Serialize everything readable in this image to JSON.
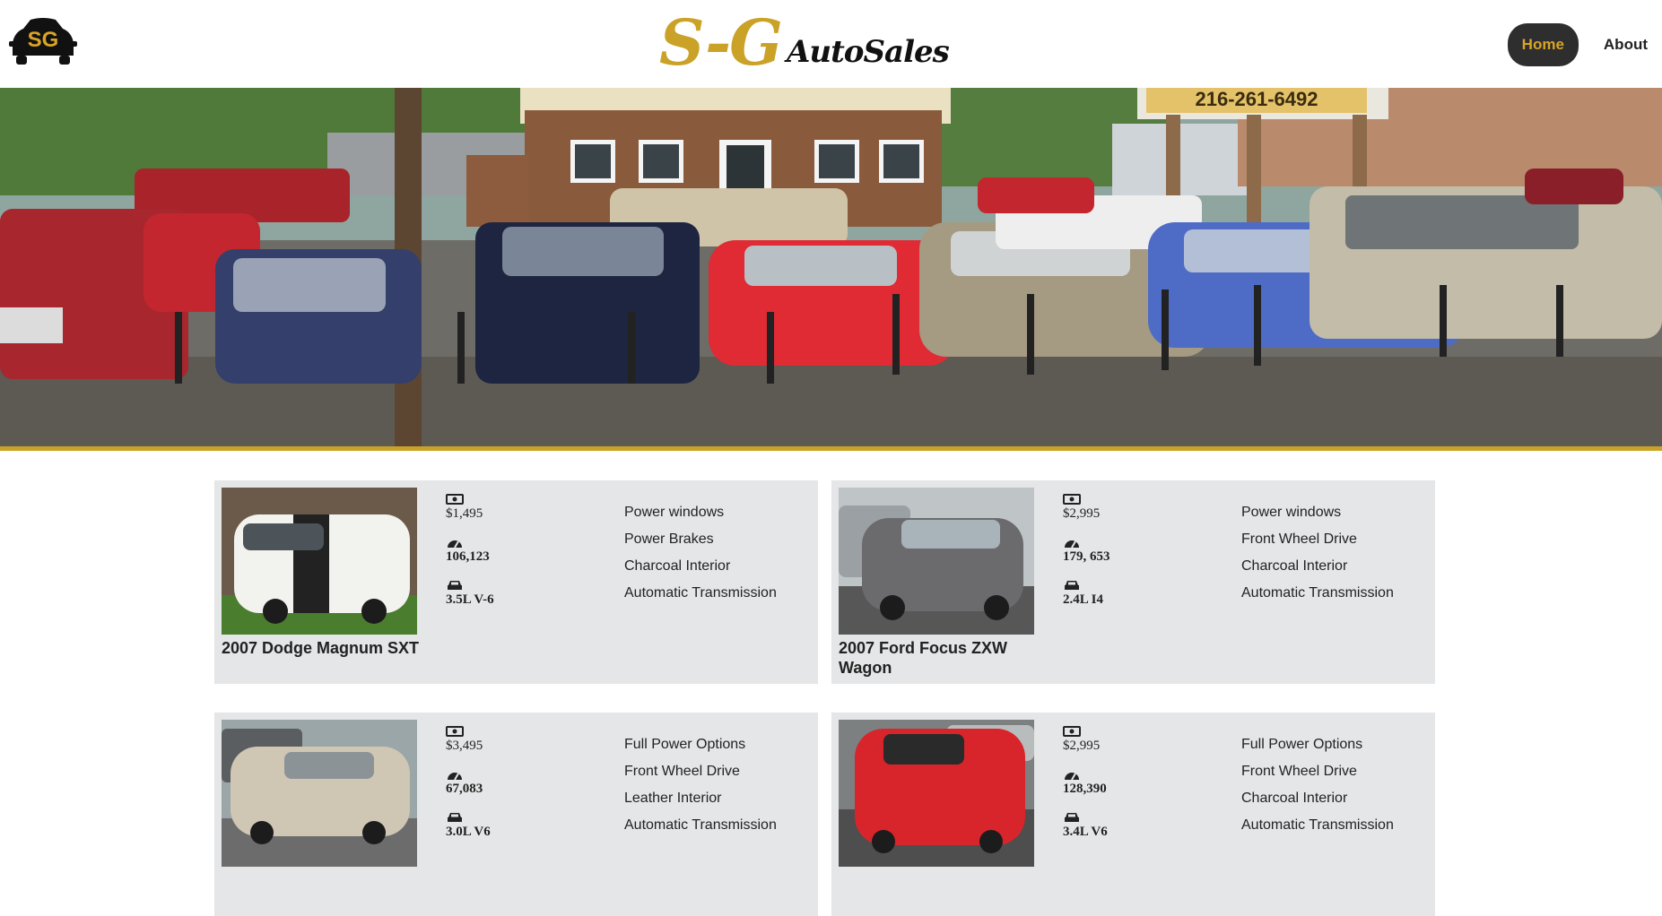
{
  "header": {
    "logo_text": "SG",
    "brand_main": "S-G",
    "brand_sub": "AutoSales",
    "nav": [
      {
        "label": "Home",
        "active": true
      },
      {
        "label": "About",
        "active": false
      }
    ]
  },
  "hero": {
    "sign_text": "216-261-6492"
  },
  "colors": {
    "accent_gold": "#c9a227",
    "nav_active_bg": "#2e2e2e",
    "card_bg": "#e5e6e7"
  },
  "listings": [
    {
      "title": "2007 Dodge Magnum SXT",
      "price": "$1,495",
      "mileage": "106,123",
      "engine": "3.5L V-6",
      "features": [
        "Power windows",
        "Power Brakes",
        "Charcoal Interior",
        "Automatic Transmission"
      ],
      "car_color": "#f2f2ee"
    },
    {
      "title": "2007 Ford Focus ZXW Wagon",
      "price": "$2,995",
      "mileage": "179, 653",
      "engine": "2.4L I4",
      "features": [
        "Power windows",
        "Front Wheel Drive",
        "Charcoal Interior",
        "Automatic Transmission"
      ],
      "car_color": "#6b6b6e"
    },
    {
      "title": "",
      "price": "$3,495",
      "mileage": "67,083",
      "engine": "3.0L V6",
      "features": [
        "Full Power Options",
        "Front Wheel Drive",
        "Leather Interior",
        "Automatic Transmission"
      ],
      "car_color": "#cfc7b4"
    },
    {
      "title": "",
      "price": "$2,995",
      "mileage": "128,390",
      "engine": "3.4L V6",
      "features": [
        "Full Power Options",
        "Front Wheel Drive",
        "Charcoal Interior",
        "Automatic Transmission"
      ],
      "car_color": "#d8252b"
    }
  ]
}
